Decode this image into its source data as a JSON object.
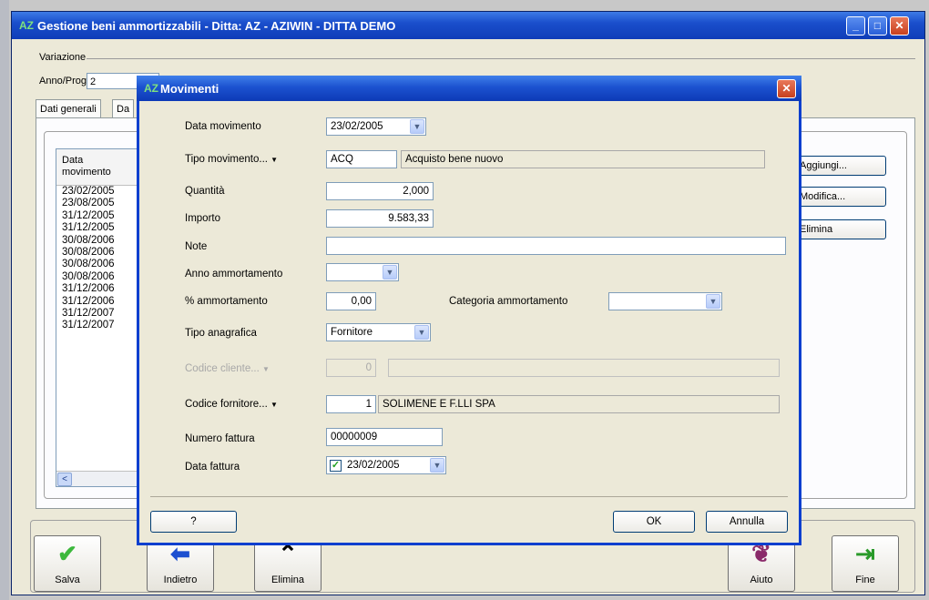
{
  "window": {
    "title": "Gestione beni ammortizzabili - Ditta: AZ - AZIWIN - DITTA DEMO",
    "logo": "AZ"
  },
  "frame": {
    "legend": "Variazione",
    "anno_label": "Anno/Progr.",
    "anno_value": "2"
  },
  "tabs": [
    "Dati generali",
    "Da"
  ],
  "list": {
    "header": [
      "Data",
      "movimento"
    ],
    "rows": [
      "23/02/2005",
      "23/08/2005",
      "31/12/2005",
      "31/12/2005",
      "30/08/2006",
      "30/08/2006",
      "30/08/2006",
      "30/08/2006",
      "31/12/2006",
      "31/12/2006",
      "31/12/2007",
      "31/12/2007"
    ],
    "scroll_left": "<"
  },
  "side_buttons": {
    "aggiungi": "Aggiungi...",
    "modifica": "Modifica...",
    "elimina": "Elimina"
  },
  "bottom_buttons": {
    "salva": "Salva",
    "indietro": "Indietro",
    "elimina": "Elimina",
    "aiuto": "Aiuto",
    "fine": "Fine"
  },
  "dialog": {
    "title": "Movimenti",
    "fields": {
      "data_movimento": {
        "label": "Data movimento",
        "value": "23/02/2005"
      },
      "tipo_movimento": {
        "label": "Tipo movimento...",
        "code": "ACQ",
        "description": "Acquisto bene nuovo"
      },
      "quantita": {
        "label": "Quantità",
        "value": "2,000"
      },
      "importo": {
        "label": "Importo",
        "value": "9.583,33"
      },
      "note": {
        "label": "Note",
        "value": ""
      },
      "anno_ammortamento": {
        "label": "Anno ammortamento",
        "value": ""
      },
      "perc_ammortamento": {
        "label": "% ammortamento",
        "value": "0,00"
      },
      "categoria_ammortamento": {
        "label": "Categoria ammortamento",
        "value": ""
      },
      "tipo_anagrafica": {
        "label": "Tipo anagrafica",
        "value": "Fornitore"
      },
      "codice_cliente": {
        "label": "Codice cliente...",
        "value": "0",
        "description": ""
      },
      "codice_fornitore": {
        "label": "Codice fornitore...",
        "value": "1",
        "description": "SOLIMENE E F.LLI SPA"
      },
      "numero_fattura": {
        "label": "Numero fattura",
        "value": "00000009"
      },
      "data_fattura": {
        "label": "Data fattura",
        "value": "23/02/2005",
        "checked": true
      }
    },
    "buttons": {
      "help": "?",
      "ok": "OK",
      "annulla": "Annulla"
    }
  },
  "icons": {
    "minimize": "minimize-icon",
    "maximize": "maximize-icon",
    "close": "close-icon",
    "dropdown": "chevron-down-icon",
    "menu_arrow": "triangle-down-icon"
  },
  "colors": {
    "titlebar": "#1a4fcc",
    "window_bg": "#ece9d8",
    "close_button": "#c8401e"
  }
}
